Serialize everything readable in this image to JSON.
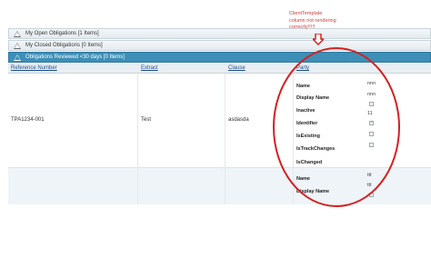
{
  "groups": [
    {
      "label": "My Open Obligations [1 Items]"
    },
    {
      "label": "My Closed Obligations [0 Items]"
    },
    {
      "label": "Obligations Reviewed <30 days [0 Items]"
    }
  ],
  "grid": {
    "columns": [
      "Reference Number",
      "Extract",
      "Clause",
      "Party"
    ],
    "row1": {
      "reference": "TPA1234-001",
      "extract": "Test",
      "clause": "asdasda",
      "party": {
        "labels": [
          "Name",
          "Display Name",
          "Inactive",
          "Identifier",
          "IsExisting",
          "IsTrackChanges",
          "IsChanged"
        ],
        "name_value": "nnn",
        "display_name_value": "nnn",
        "identifier_value": "11"
      }
    },
    "row2": {
      "party": {
        "labels": [
          "Name",
          "Display Name"
        ],
        "name_value": "ttt",
        "display_name_value": "ttt"
      }
    }
  },
  "annotation": {
    "lines": [
      "ClientTemplate",
      "column not rendering",
      "correctly!!!!!"
    ],
    "color": "#d13a3a"
  },
  "colors": {
    "active_group": "#3d8fb7",
    "annotation_red": "#d42020",
    "link": "#1a4d8c"
  }
}
